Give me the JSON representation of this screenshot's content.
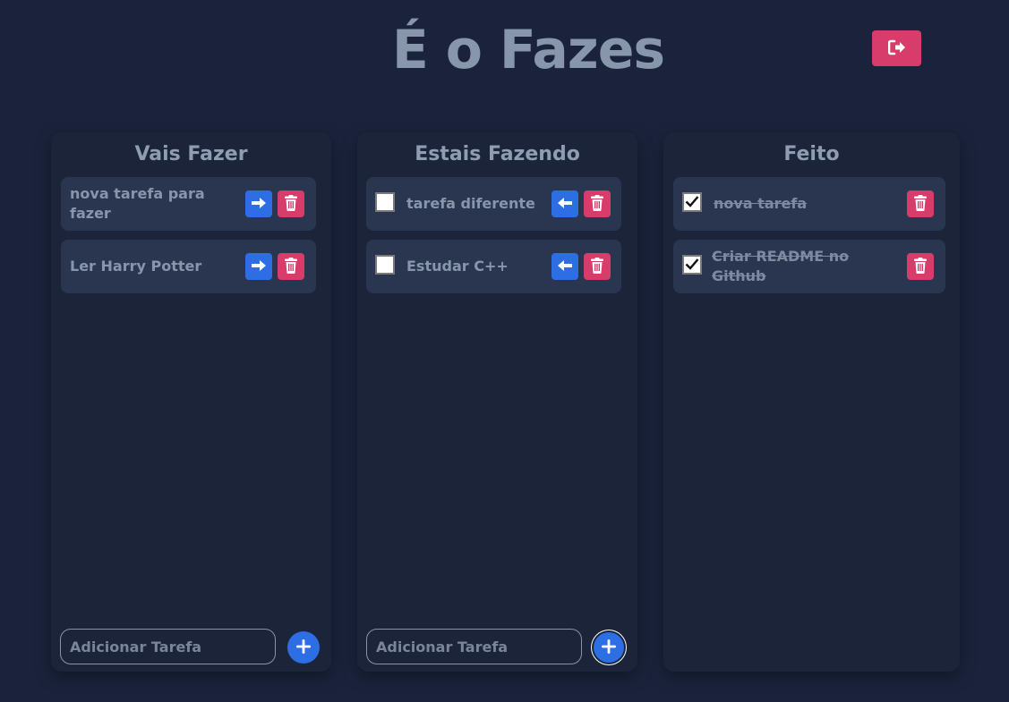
{
  "app": {
    "title": "É o Fazes",
    "logout_icon": "sign-out-icon"
  },
  "columns": {
    "todo": {
      "title": "Vais Fazer",
      "cards": [
        {
          "text": "nova tarefa para fazer"
        },
        {
          "text": "Ler Harry Potter"
        }
      ],
      "input_placeholder": "Adicionar Tarefa"
    },
    "doing": {
      "title": "Estais Fazendo",
      "cards": [
        {
          "text": "tarefa diferente",
          "checked": false
        },
        {
          "text": "Estudar C++",
          "checked": false
        }
      ],
      "input_placeholder": "Adicionar Tarefa"
    },
    "done": {
      "title": "Feito",
      "cards": [
        {
          "text": "nova tarefa",
          "checked": true
        },
        {
          "text": "Criar README no Github",
          "checked": true
        }
      ]
    }
  },
  "colors": {
    "background": "#1a233b",
    "card": "#2a3650",
    "primary": "#2d6ee5",
    "danger": "#d83c6b",
    "text": "#8796ab"
  }
}
